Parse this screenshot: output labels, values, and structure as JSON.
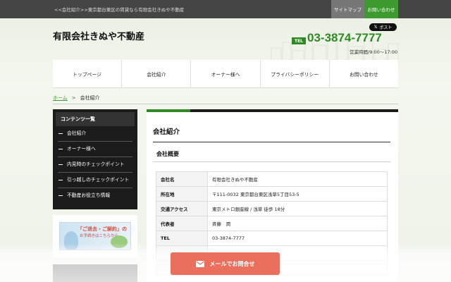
{
  "topbar": {
    "breadcrumb_text": "<<会社紹介>>東京都台東区の賃貸なら有限会社きぬや不動産",
    "sitemap_label": "サイトマップ",
    "contact_label": "お問い合わせ"
  },
  "header": {
    "company_name": "有限会社きぬや不動産",
    "x_post_label": "ポスト",
    "tel_badge": "TEL",
    "tel_number": "03-3874-7777",
    "hours": "営業時間/9:00～17:00"
  },
  "nav": {
    "items": [
      {
        "label": "トップページ"
      },
      {
        "label": "会社紹介"
      },
      {
        "label": "オーナー様へ"
      },
      {
        "label": "プライバシーポリシー"
      },
      {
        "label": "お問い合わせ"
      }
    ]
  },
  "breadcrumb": {
    "home": "ホーム",
    "separator": ">",
    "current": "会社紹介"
  },
  "sidebar": {
    "heading": "コンテンツ一覧",
    "links": [
      {
        "label": "会社紹介"
      },
      {
        "label": "オーナー様へ"
      },
      {
        "label": "内見時のチェックポイント"
      },
      {
        "label": "引っ越しのチェックポイント"
      },
      {
        "label": "不動産お役立ち情報"
      }
    ],
    "banner_caption": "「ご退去・ご解約」の",
    "banner_caption2": "お手続きはこちらから"
  },
  "main": {
    "title": "会社紹介",
    "subtitle": "会社概要",
    "profile": [
      {
        "key": "会社名",
        "value": "有限会社きぬや不動産"
      },
      {
        "key": "所在地",
        "value": "〒111-0032 東京都台東区浅草5丁目53-5"
      },
      {
        "key": "交通アクセス",
        "value": "東京メトロ銀座線 / 浅草 徒歩 18分"
      },
      {
        "key": "代表者",
        "value": "斉藤　潤"
      },
      {
        "key": "TEL",
        "value": "03-3874-7777"
      }
    ]
  },
  "float_button": {
    "label": "メールでお問合せ",
    "icon": "mail-icon"
  },
  "colors": {
    "accent_green": "#2f8a24",
    "mail_button": "#ea6f5d",
    "dark": "#1b1b1b"
  }
}
